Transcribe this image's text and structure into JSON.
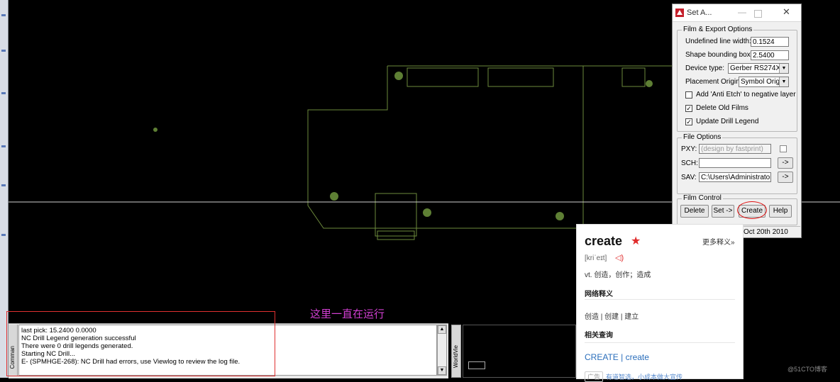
{
  "dialog": {
    "title": "Set A...",
    "film_export": {
      "group_label": "Film & Export Options",
      "undefined_line_width_label": "Undefined line width:",
      "undefined_line_width_value": "0.1524",
      "shape_bounding_box_label": "Shape bounding box:",
      "shape_bounding_box_value": "2.5400",
      "device_type_label": "Device type:",
      "device_type_value": "Gerber RS274X",
      "placement_origin_label": "Placement Origin:",
      "placement_origin_value": "Symbol Origin",
      "anti_etch_label": "Add 'Anti Etch' to negative layer",
      "anti_etch_checked": false,
      "delete_old_films_label": "Delete Old Films",
      "delete_old_films_checked": true,
      "update_drill_legend_label": "Update Drill Legend",
      "update_drill_legend_checked": true
    },
    "file_options": {
      "group_label": "File Options",
      "pxy_label": "PXY:",
      "pxy_value": "(design by fastprint)",
      "sch_label": "SCH:",
      "sch_value": "",
      "sav_label": "SAV:",
      "sav_value": "C:\\Users\\Administrator\\",
      "browse_label": "->"
    },
    "film_control": {
      "group_label": "Film Control",
      "delete_label": "Delete",
      "set_label": "Set ->",
      "create_label": "Create",
      "help_label": "Help"
    },
    "status_date": "Oct 20th 2010"
  },
  "dictionary": {
    "word": "create",
    "star": "★",
    "more": "更多释义»",
    "phonetic": "[kriˈeɪt]",
    "definition": "vt. 创造，创作；造成",
    "web_section": "网络释义",
    "web_meanings": "创造 | 创建 | 建立",
    "related_section": "相关查询",
    "related_links": "CREATE | create",
    "ad_tag": "广告",
    "ad_text": "有道智选，小成本做大宣传"
  },
  "command_window": {
    "side_label": "Comman",
    "lines": [
      "last pick:  15.2400  0.0000",
      "NC Drill Legend generation successful",
      "There were 0 drill legends generated.",
      "Starting NC Drill...",
      "E- (SPMHGE-268): NC Drill had errors, use Viewlog to review the log file."
    ]
  },
  "worldview": {
    "side_label": "WorldVie"
  },
  "annotation": "这里一直在运行",
  "watermark": "@51CTO博客"
}
